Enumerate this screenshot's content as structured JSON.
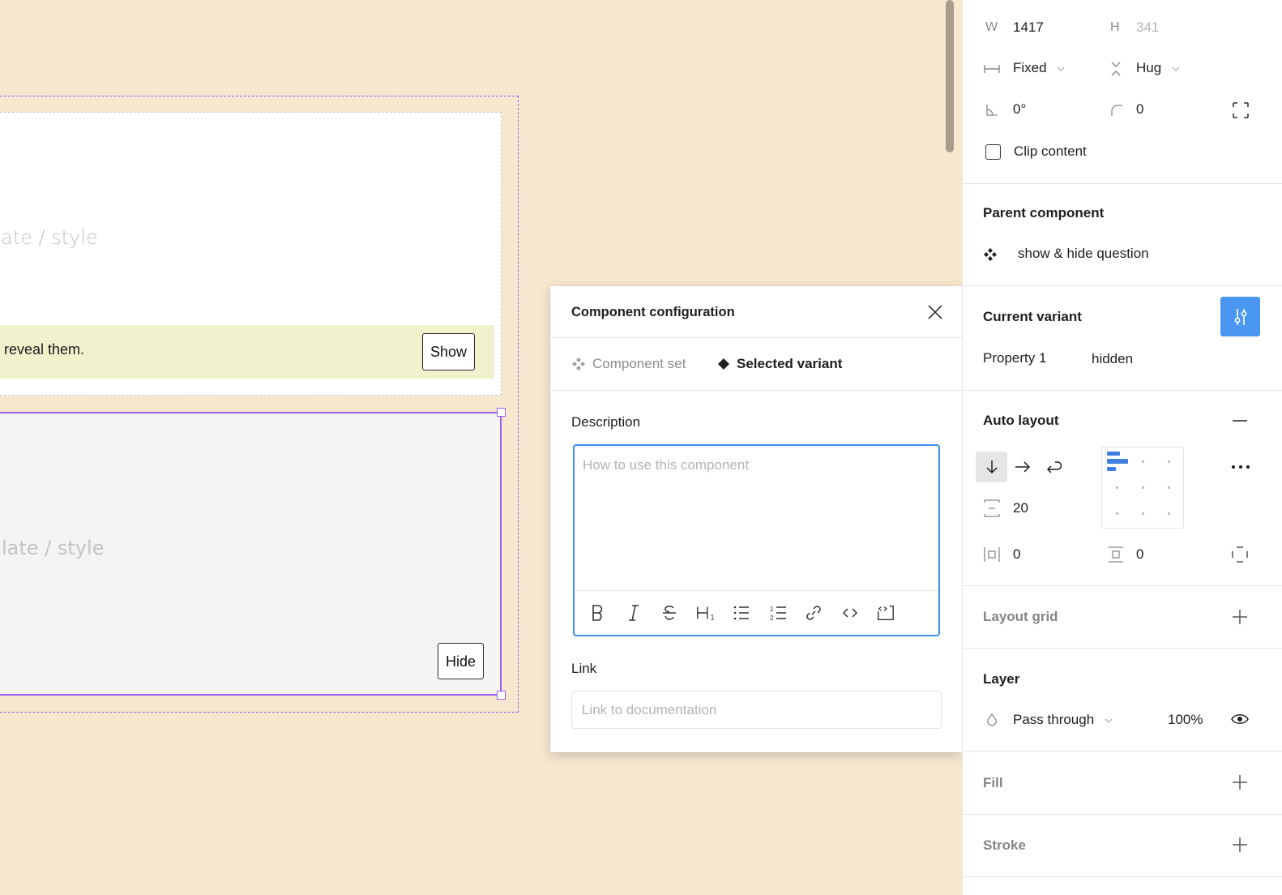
{
  "canvas": {
    "top_card": {
      "ghost_text": "ate / style",
      "reveal_text": "reveal them.",
      "show_button": "Show"
    },
    "bottom_card": {
      "ghost_text": "late / style",
      "hide_button": "Hide"
    },
    "colors": {
      "background": "#f6e8cf",
      "selection": "#9b5cf2",
      "reveal_bar": "#f1f2cd"
    }
  },
  "modal": {
    "title": "Component configuration",
    "tabs": [
      {
        "label": "Component set",
        "icon": "component-set-icon",
        "active": false
      },
      {
        "label": "Selected variant",
        "icon": "variant-diamond-icon",
        "active": true
      }
    ],
    "description": {
      "label": "Description",
      "value": "",
      "placeholder": "How to use this component"
    },
    "toolbar": [
      "bold",
      "italic",
      "strikethrough",
      "heading-1",
      "bulleted-list",
      "numbered-list",
      "link",
      "code",
      "code-block"
    ],
    "link": {
      "label": "Link",
      "value": "",
      "placeholder": "Link to documentation"
    }
  },
  "panel": {
    "dimensions": {
      "w_label": "W",
      "w_value": "1417",
      "h_label": "H",
      "h_value": "341",
      "width_mode": "Fixed",
      "height_mode": "Hug",
      "rotation": "0°",
      "radius": "0"
    },
    "clip_content": {
      "label": "Clip content",
      "checked": false
    },
    "parent_component": {
      "title": "Parent component",
      "name": "show & hide question"
    },
    "current_variant": {
      "title": "Current variant",
      "property_label": "Property 1",
      "property_value": "hidden"
    },
    "auto_layout": {
      "title": "Auto layout",
      "direction": "vertical",
      "spacing": "20",
      "padding_horizontal": "0",
      "padding_vertical": "0"
    },
    "layout_grid": {
      "title": "Layout grid"
    },
    "layer": {
      "title": "Layer",
      "blend_mode": "Pass through",
      "opacity": "100%"
    },
    "fill": {
      "title": "Fill"
    },
    "stroke": {
      "title": "Stroke"
    },
    "accent": "#4a97f2"
  }
}
